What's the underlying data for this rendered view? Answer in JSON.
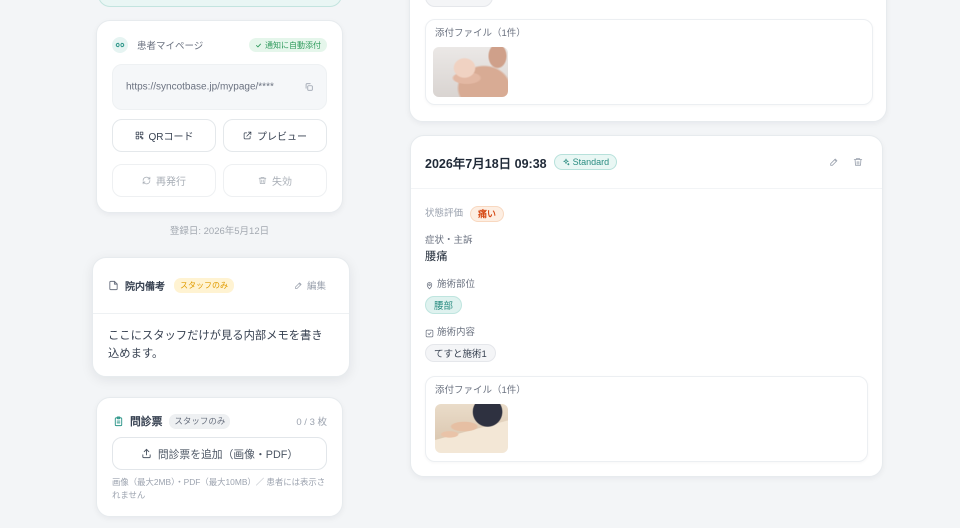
{
  "colors": {
    "background": "#f3f5f7",
    "card_border": "#e7ebee",
    "accent": "#2a9487",
    "accent_soft": "#e6f4f2",
    "text_primary": "#1f2937",
    "notify_badge_bg": "#e5f6eb",
    "notify_badge_text": "#2f9a5c",
    "staff_badge_bg": "#fff3d2",
    "staff_badge_text": "#e09b00",
    "pain_badge_bg": "#fdeee2",
    "pain_badge_text": "#d64a16",
    "area_badge_bg": "#dff2ef",
    "area_badge_text": "#2a8c80"
  },
  "icons": {
    "mypage": "link-icon",
    "auto_attach": "check-icon",
    "copy": "copy-icon",
    "qr": "qr-code-icon",
    "preview": "external-link-icon",
    "reissue": "refresh-icon",
    "revoke": "trash-icon",
    "notes": "document-icon",
    "edit": "pencil-icon",
    "questionnaire": "clipboard-icon",
    "upload": "upload-icon",
    "plan": "sparkle-icon",
    "area": "map-pin-icon",
    "content": "check-square-icon",
    "delete": "trash-icon"
  },
  "left": {
    "patient_mypage": {
      "title": "患者マイページ",
      "auto_attach_badge": "通知に自動添付",
      "url": "https://syncotbase.jp/mypage/****",
      "qr_button": "QRコード",
      "preview_button": "プレビュー",
      "reissue_button": "再発行",
      "revoke_button": "失効"
    },
    "registered_date": "登録日: 2026年5月12日",
    "internal_notes": {
      "title": "院内備考",
      "badge": "スタッフのみ",
      "edit_label": "編集",
      "body": "ここにスタッフだけが見る内部メモを書き込めます。"
    },
    "questionnaire": {
      "title": "問診票",
      "badge": "スタッフのみ",
      "count": "0 / 3 枚",
      "add_button": "問診票を追加（画像・PDF）",
      "help_text": "画像（最大2MB）・PDF（最大10MB）／ 患者には表示されません"
    }
  },
  "right": {
    "previous_record": {
      "attachments_label": "添付ファイル（1件）"
    },
    "record": {
      "datetime": "2026年7月18日 09:38",
      "plan_badge": "Standard",
      "condition": {
        "label": "状態評価",
        "value": "痛い"
      },
      "complaint": {
        "label": "症状・主訴",
        "value": "腰痛"
      },
      "treatment_area": {
        "label": "施術部位",
        "value": "腰部"
      },
      "treatment_content": {
        "label": "施術内容",
        "value": "てすと施術1"
      },
      "attachments_label": "添付ファイル（1件）"
    }
  }
}
